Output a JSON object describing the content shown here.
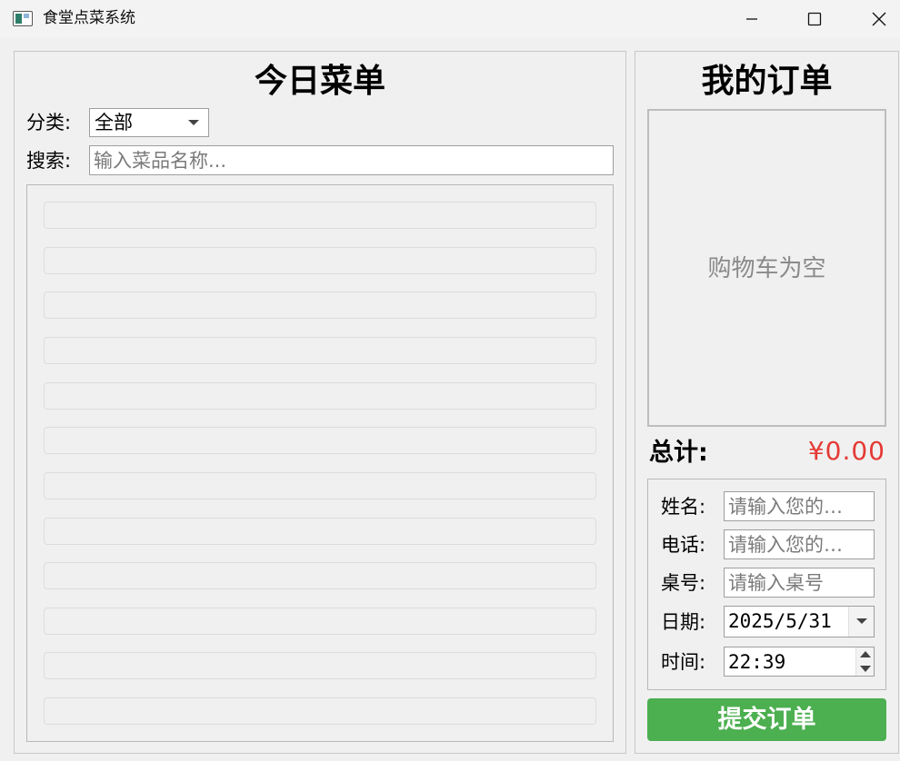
{
  "window": {
    "title": "食堂点菜系统"
  },
  "menu_panel": {
    "title": "今日菜单",
    "category_label": "分类:",
    "category_value": "全部",
    "search_label": "搜索:",
    "search_placeholder": "输入菜品名称..."
  },
  "order_panel": {
    "title": "我的订单",
    "cart_empty_text": "购物车为空",
    "total_label": "总计:",
    "total_value": "¥0.00",
    "form": {
      "name_label": "姓名:",
      "name_placeholder": "请输入您的…",
      "phone_label": "电话:",
      "phone_placeholder": "请输入您的…",
      "table_label": "桌号:",
      "table_placeholder": "请输入桌号",
      "date_label": "日期:",
      "date_value": "2025/5/31",
      "time_label": "时间:",
      "time_value": "22:39"
    },
    "submit_label": "提交订单"
  },
  "colors": {
    "accent_green": "#4caf50",
    "total_red": "#e53935"
  }
}
